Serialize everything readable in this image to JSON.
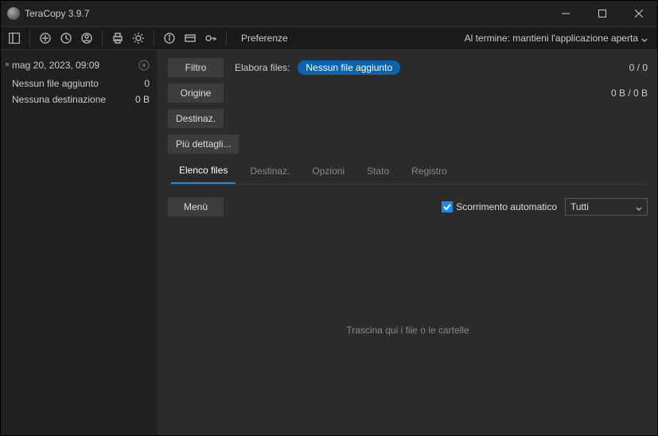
{
  "title": "TeraCopy 3.9.7",
  "toolbar": {
    "preferences_label": "Preferenze",
    "on_finish_label": "Al termine: mantieni l'applicazione aperta"
  },
  "sidebar": {
    "entry": {
      "timestamp": "mag 20, 2023, 09:09",
      "line1_label": "Nessun file aggiunto",
      "line1_value": "0",
      "line2_label": "Nessuna destinazione",
      "line2_value": "0 B"
    }
  },
  "main": {
    "filter_btn": "Filtro",
    "process_label": "Elabora files:",
    "no_file_pill": "Nessun file aggiunto",
    "count": "0 / 0",
    "origin_btn": "Origine",
    "size_ratio": "0 B / 0 B",
    "dest_btn": "Destinaz.",
    "more_btn": "Più dettagli...",
    "tabs": {
      "list": "Elenco files",
      "dest": "Destinaz.",
      "options": "Opzioni",
      "status": "Stato",
      "log": "Registro"
    },
    "menu_btn": "Menù",
    "autoscroll_label": "Scorrimento automatico",
    "filter_select": "Tutti",
    "drop_hint": "Trascina qui i file o le cartelle"
  }
}
